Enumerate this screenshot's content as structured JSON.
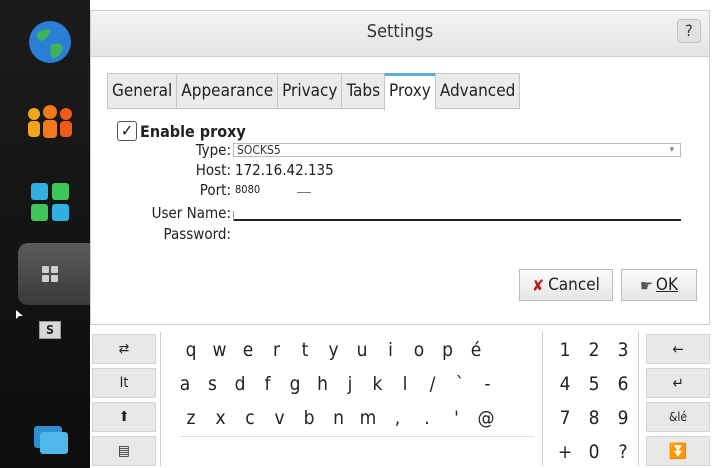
{
  "window": {
    "title": "Settings",
    "help_label": "?"
  },
  "tabs": [
    {
      "label": "General"
    },
    {
      "label": "Appearance"
    },
    {
      "label": "Privacy"
    },
    {
      "label": "Tabs"
    },
    {
      "label": "Proxy"
    },
    {
      "label": "Advanced"
    }
  ],
  "active_tab": "Proxy",
  "proxy": {
    "enable_label": "Enable proxy",
    "enable_checked": true,
    "check_mark": "✓",
    "type_label": "Type:",
    "type_value": "SOCKS5",
    "host_label": "Host:",
    "host_value": "172.16.42.135",
    "port_label": "Port:",
    "port_value": "8080",
    "username_label": "User Name:",
    "username_value": "",
    "password_label": "Password:",
    "password_value": ""
  },
  "buttons": {
    "cancel_label": "Cancel",
    "ok_label": "OK"
  },
  "sidebar": {
    "items": [
      {
        "icon": "globe-icon"
      },
      {
        "icon": "contacts-icon"
      },
      {
        "icon": "apps-icon"
      },
      {
        "icon": "dashboard-icon"
      },
      {
        "icon": "switcher-icon"
      },
      {
        "icon": "window-icon"
      }
    ],
    "switcher_label": "S"
  },
  "keyboard": {
    "left_keys": [
      "⇄",
      "It",
      "⬆",
      "▤"
    ],
    "rows": [
      [
        "q",
        "w",
        "e",
        "r",
        "t",
        "y",
        "u",
        "i",
        "o",
        "p",
        "é"
      ],
      [
        "a",
        "s",
        "d",
        "f",
        "g",
        "h",
        "j",
        "k",
        "l",
        "/",
        "`",
        "-"
      ],
      [
        "z",
        "x",
        "c",
        "v",
        "b",
        "n",
        "m",
        ",",
        ".",
        "'",
        "@"
      ]
    ],
    "num_rows": [
      [
        "1",
        "2",
        "3"
      ],
      [
        "4",
        "5",
        "6"
      ],
      [
        "7",
        "8",
        "9"
      ],
      [
        "+",
        "0",
        "?"
      ]
    ],
    "right_keys": [
      "←",
      "↵",
      "&lé",
      "⏬"
    ]
  },
  "colors": {
    "accent": "#5aaed8",
    "cancel_icon": "#b42020",
    "sidebar_bg": "#111111"
  }
}
